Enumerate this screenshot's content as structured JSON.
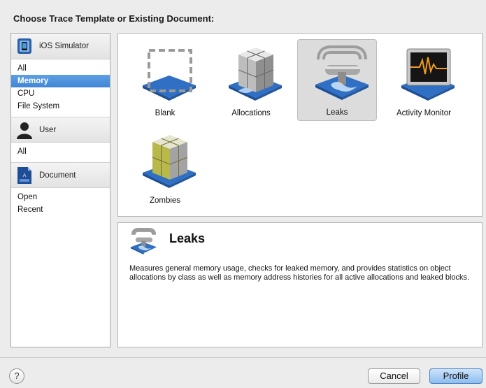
{
  "dialog": {
    "title": "Choose Trace Template or Existing Document:"
  },
  "sidebar": {
    "groups": [
      {
        "label": "iOS Simulator",
        "icon": "ios-simulator-icon",
        "items": [
          {
            "label": "All"
          },
          {
            "label": "Memory",
            "selected": true
          },
          {
            "label": "CPU"
          },
          {
            "label": "File System"
          }
        ]
      },
      {
        "label": "User",
        "icon": "user-icon",
        "items": [
          {
            "label": "All"
          }
        ]
      },
      {
        "label": "Document",
        "icon": "document-icon",
        "items": [
          {
            "label": "Open"
          },
          {
            "label": "Recent"
          }
        ]
      }
    ]
  },
  "templates": [
    {
      "label": "Blank",
      "icon": "blank-template-icon"
    },
    {
      "label": "Allocations",
      "icon": "allocations-template-icon"
    },
    {
      "label": "Leaks",
      "icon": "leaks-template-icon",
      "selected": true
    },
    {
      "label": "Activity Monitor",
      "icon": "activity-monitor-template-icon"
    },
    {
      "label": "Zombies",
      "icon": "zombies-template-icon"
    }
  ],
  "detail": {
    "title": "Leaks",
    "icon": "leaks-icon",
    "description": "Measures general memory usage, checks for leaked memory, and provides statistics on object allocations by class as well as memory address histories for all active allocations and leaked blocks."
  },
  "footer": {
    "help_label": "?",
    "cancel_label": "Cancel",
    "profile_label": "Profile"
  },
  "colors": {
    "selection": "#3f86d6",
    "tray_blue": "#2f6fc4",
    "default_button": "#8cbdf0"
  }
}
